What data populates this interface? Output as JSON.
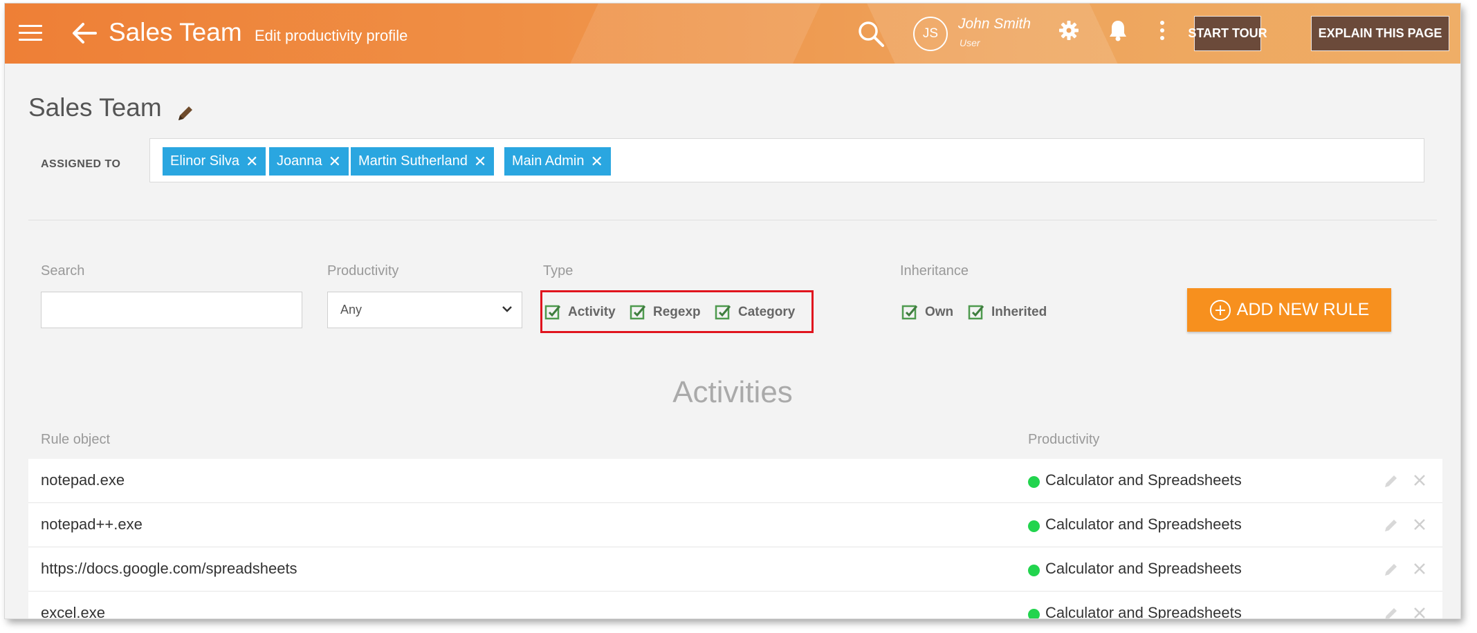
{
  "header": {
    "title": "Sales Team",
    "subtitle": "Edit productivity profile",
    "user": {
      "initials": "JS",
      "name": "John Smith",
      "role": "User"
    },
    "start_tour": "START TOUR",
    "explain": "EXPLAIN THIS PAGE",
    "colors": {
      "gradient_start": "#ee7f36",
      "gradient_end": "#efae67",
      "button_bg": "#6b4a3a"
    }
  },
  "profile": {
    "name": "Sales Team",
    "assigned_label": "ASSIGNED TO",
    "assigned": [
      "Elinor Silva",
      "Joanna",
      "Martin Sutherland",
      "Main Admin"
    ],
    "chip_color": "#2aa6e0"
  },
  "filters": {
    "search_label": "Search",
    "search_value": "",
    "productivity_label": "Productivity",
    "productivity_value": "Any",
    "type_label": "Type",
    "type_options": [
      {
        "label": "Activity",
        "checked": true
      },
      {
        "label": "Regexp",
        "checked": true
      },
      {
        "label": "Category",
        "checked": true
      }
    ],
    "inheritance_label": "Inheritance",
    "inheritance_options": [
      {
        "label": "Own",
        "checked": true
      },
      {
        "label": "Inherited",
        "checked": true
      }
    ],
    "add_button": "ADD NEW RULE",
    "add_button_color": "#f7901e",
    "highlight_color": "#e0141e"
  },
  "activities": {
    "title": "Activities",
    "col_rule": "Rule object",
    "col_productivity": "Productivity",
    "status_color": "#22d44e",
    "rows": [
      {
        "object": "notepad.exe",
        "productivity": "Calculator and Spreadsheets"
      },
      {
        "object": "notepad++.exe",
        "productivity": "Calculator and Spreadsheets"
      },
      {
        "object": "https://docs.google.com/spreadsheets",
        "productivity": "Calculator and Spreadsheets"
      },
      {
        "object": "excel.exe",
        "productivity": "Calculator and Spreadsheets"
      }
    ]
  }
}
